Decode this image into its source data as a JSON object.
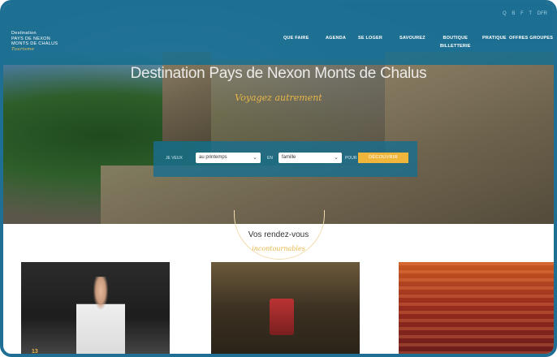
{
  "header": {
    "logo": {
      "line1": "Destination",
      "line2": "PAYS DE NEXON",
      "line3": "MONTS DE CHALUS",
      "script": "Tourisme"
    },
    "utility": [
      "Q",
      "B",
      "F",
      "T",
      "DFR"
    ],
    "nav": [
      {
        "label": "QUE FAIRE"
      },
      {
        "label": "AGENDA"
      },
      {
        "label": "SE LOGER"
      },
      {
        "label": "SAVOUREZ"
      },
      {
        "label": "BOUTIQUE"
      },
      {
        "label": "PRATIQUE"
      },
      {
        "label": "OFFRES GROUPES"
      }
    ],
    "nav_sub": "BILLETTERIE"
  },
  "hero": {
    "title": "Destination Pays de Nexon Monts de Chalus",
    "subtitle": "Voyagez autrement"
  },
  "search": {
    "label_when": "JE VEUX",
    "period_value": "au printemps",
    "label_with": "EN",
    "who_value": "famille",
    "label_for": "POUR",
    "button": "DÉCOUVRIR"
  },
  "agenda": {
    "title": "Vos rendez-vous",
    "subtitle": "incontournables",
    "first_date": "13"
  },
  "colors": {
    "frame": "#1e6f93",
    "bar": "#186e8e",
    "accent": "#e8b64a",
    "button": "#f0b63c"
  }
}
